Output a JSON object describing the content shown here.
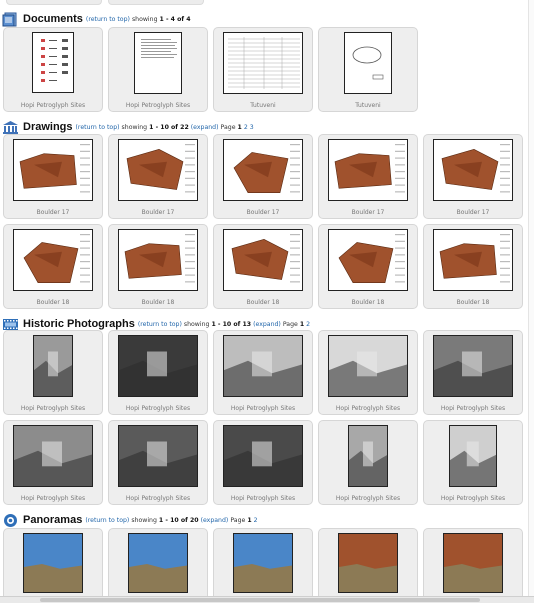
{
  "sections": {
    "documents": {
      "title": "Documents",
      "return_link": "(return to top)",
      "showing": "showing",
      "range": "1 - 4 of 4",
      "items": [
        "Hopi Petroglyph Sites",
        "Hopi Petroglyph Sites",
        "Tutuveni",
        "Tutuveni"
      ]
    },
    "drawings": {
      "title": "Drawings",
      "return_link": "(return to top)",
      "showing": "showing",
      "range": "1 - 10 of 22",
      "expand": "(expand)",
      "page_label": "Page",
      "pages": [
        "1",
        "2",
        "3"
      ],
      "items": [
        "Boulder 17",
        "Boulder 17",
        "Boulder 17",
        "Boulder 17",
        "Boulder 17",
        "Boulder 18",
        "Boulder 18",
        "Boulder 18",
        "Boulder 18",
        "Boulder 18"
      ]
    },
    "historic": {
      "title": "Historic Photographs",
      "return_link": "(return to top)",
      "showing": "showing",
      "range": "1 - 10 of 13",
      "expand": "(expand)",
      "page_label": "Page",
      "pages": [
        "1",
        "2"
      ],
      "items": [
        "Hopi Petroglyph Sites",
        "Hopi Petroglyph Sites",
        "Hopi Petroglyph Sites",
        "Hopi Petroglyph Sites",
        "Hopi Petroglyph Sites",
        "Hopi Petroglyph Sites",
        "Hopi Petroglyph Sites",
        "Hopi Petroglyph Sites",
        "Hopi Petroglyph Sites",
        "Hopi Petroglyph Sites"
      ]
    },
    "panoramas": {
      "title": "Panoramas",
      "return_link": "(return to top)",
      "showing": "showing",
      "range": "1 - 10 of 20",
      "expand": "(expand)",
      "page_label": "Page",
      "pages": [
        "1",
        "2"
      ]
    }
  },
  "colors": {
    "link": "#2266aa",
    "tile_bg": "#eeeeee",
    "rock": "#a0522d",
    "sky": "#4a86c8"
  },
  "icons": {
    "documents": "document-stack-icon",
    "drawings": "museum-building-icon",
    "historic": "film-strip-icon",
    "panoramas": "panorama-circle-icon"
  }
}
